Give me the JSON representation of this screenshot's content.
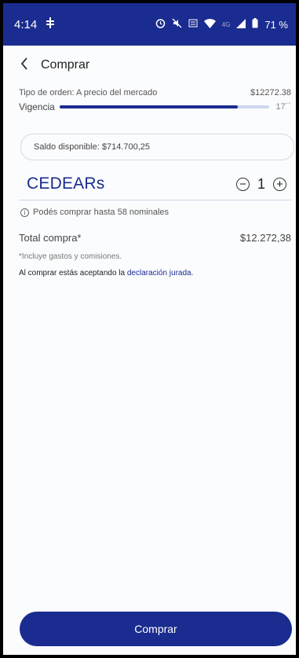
{
  "status": {
    "time": "4:14",
    "battery": "71 %",
    "network": "4G"
  },
  "header": {
    "title": "Comprar"
  },
  "order": {
    "type_label": "Tipo de orden: A precio del mercado",
    "price": "$12272.38",
    "validity_label": "Vigencia",
    "validity_time": "17´´",
    "validity_progress": 0.85
  },
  "balance": {
    "text": "Saldo disponible: $714.700,25"
  },
  "instrument": {
    "name": "CEDEARs",
    "quantity": "1",
    "minus": "−",
    "plus": "+"
  },
  "info": {
    "icon": "i",
    "text": "Podés comprar hasta 58 nominales"
  },
  "total": {
    "label": "Total compra*",
    "value": "$12.272,38"
  },
  "note": "*Incluye gastos y comisiones.",
  "legal": {
    "prefix": "Al comprar estás aceptando la ",
    "link": "declaración jurada."
  },
  "cta": {
    "label": "Comprar"
  },
  "icons": {
    "back": "chevron-left-icon",
    "info": "info-icon",
    "minus": "minus-circle-icon",
    "plus": "plus-circle-icon"
  },
  "colors": {
    "primary": "#1a2c8f",
    "background": "#fbfcfe"
  }
}
